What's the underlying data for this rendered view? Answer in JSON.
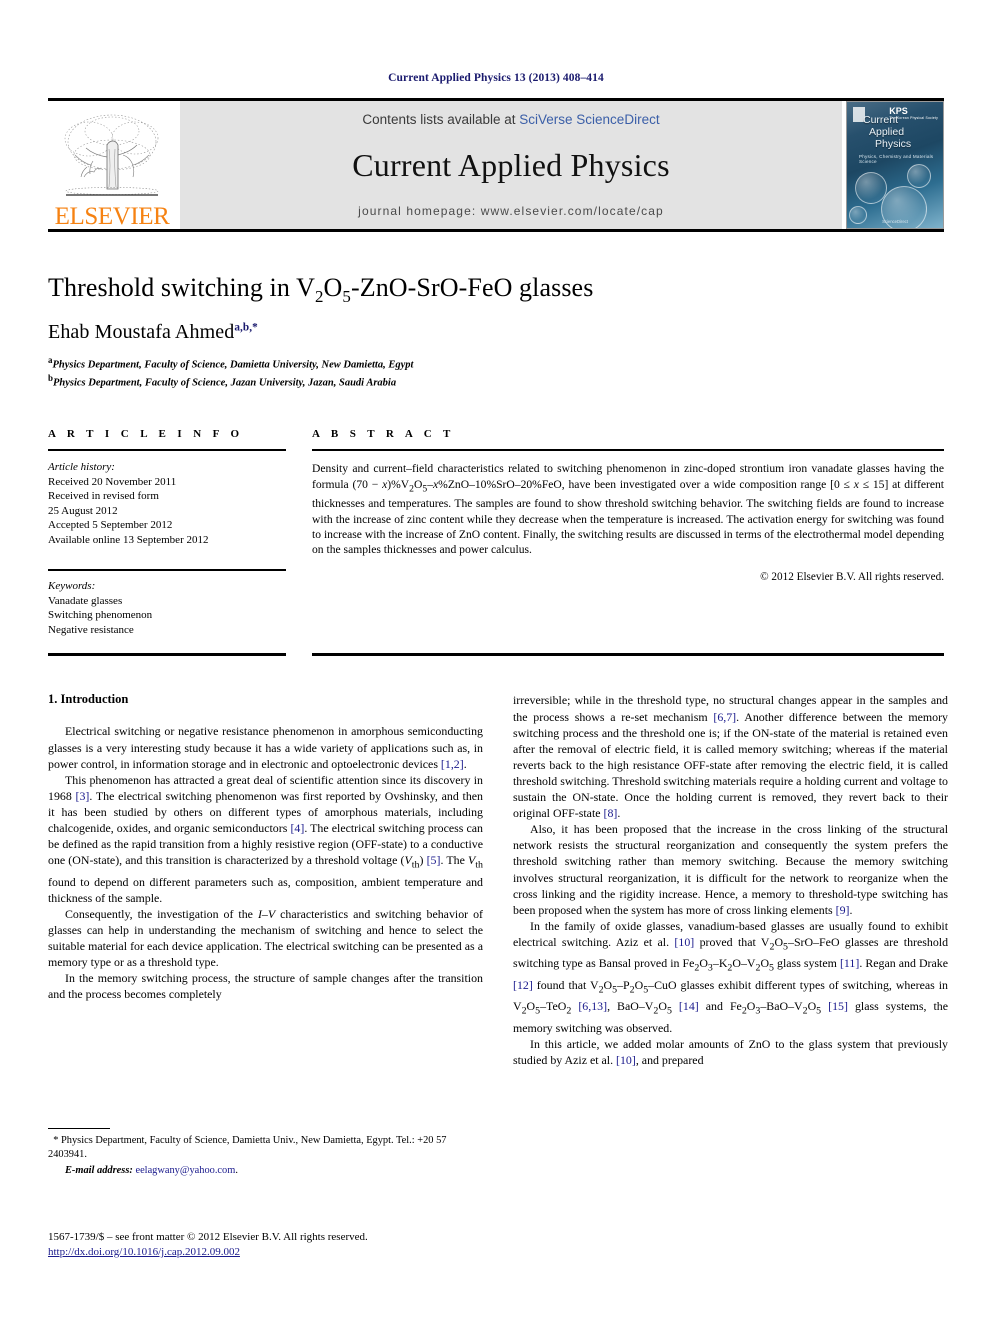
{
  "running_head": "Current Applied Physics 13 (2013) 408–414",
  "masthead": {
    "publisher_wordmark": "ELSEVIER",
    "contents_prefix": "Contents lists available at ",
    "contents_link": "SciVerse ScienceDirect",
    "journal_name": "Current Applied Physics",
    "homepage_label": "journal homepage: www.elsevier.com/locate/cap",
    "cover": {
      "title_line1": "Current",
      "title_line2": "Applied",
      "title_line3": "Physics",
      "subtitle": "Physics, Chemistry and Materials Science",
      "society_badge": "KPS",
      "society_badge_sub": "The Korean Physical Society",
      "footer": "ScienceDirect"
    }
  },
  "article": {
    "title_prefix": "Threshold switching in V",
    "title_full": "Threshold switching in V2O5-ZnO-SrO-FeO glasses",
    "title_parts": {
      "p1": "Threshold switching in V",
      "s1": "2",
      "p2": "O",
      "s2": "5",
      "p3": "-ZnO-SrO-FeO glasses"
    },
    "author": "Ehab Moustafa Ahmed",
    "author_marks": "a,b,",
    "author_star": "*",
    "affiliations": [
      {
        "mark": "a",
        "text": "Physics Department, Faculty of Science, Damietta University, New Damietta, Egypt"
      },
      {
        "mark": "b",
        "text": "Physics Department, Faculty of Science, Jazan University, Jazan, Saudi Arabia"
      }
    ]
  },
  "article_info": {
    "heading": "A R T I C L E   I N F O",
    "history_label": "Article history:",
    "history": [
      "Received 20 November 2011",
      "Received in revised form",
      "25 August 2012",
      "Accepted 5 September 2012",
      "Available online 13 September 2012"
    ],
    "keywords_label": "Keywords:",
    "keywords": [
      "Vanadate glasses",
      "Switching phenomenon",
      "Negative resistance"
    ]
  },
  "abstract": {
    "heading": "A B S T R A C T",
    "p1_a": "Density and current–field characteristics related to switching phenomenon in zinc-doped strontium iron vanadate glasses having the formula (70 − ",
    "x1": "x",
    "p1_b": ")%V",
    "sub2": "2",
    "p1_c": "O",
    "sub5": "5",
    "p1_d": "–",
    "x2": "x",
    "p1_e": "%ZnO–10%SrO–20%FeO, have been investigated over a wide composition range [0 ≤ ",
    "x3": "x",
    "p1_f": " ≤ 15] at different thicknesses and temperatures. The samples are found to show threshold switching behavior. The switching fields are found to increase with the increase of zinc content while they decrease when the temperature is increased. The activation energy for switching was found to increase with the increase of ZnO content. Finally, the switching results are discussed in terms of the electrothermal model depending on the samples thicknesses and power calculus.",
    "copyright": "© 2012 Elsevier B.V. All rights reserved."
  },
  "introduction": {
    "section_number_title": "1.  Introduction",
    "left_paragraphs": [
      "Electrical switching or negative resistance phenomenon in amorphous semiconducting glasses is a very interesting study because it has a wide variety of applications such as, in power control, in information storage and in electronic and optoelectronic devices [1,2].",
      "This phenomenon has attracted a great deal of scientific attention since its discovery in 1968 [3]. The electrical switching phenomenon was first reported by Ovshinsky, and then it has been studied by others on different types of amorphous materials, including chalcogenide, oxides, and organic semiconductors [4]. The electrical switching process can be defined as the rapid transition from a highly resistive region (OFF-state) to a conductive one (ON-state), and this transition is characterized by a threshold voltage (Vth) [5]. The Vth found to depend on different parameters such as, composition, ambient temperature and thickness of the sample.",
      "Consequently, the investigation of the I–V characteristics and switching behavior of glasses can help in understanding the mechanism of switching and hence to select the suitable material for each device application. The electrical switching can be presented as a memory type or as a threshold type.",
      "In the memory switching process, the structure of sample changes after the transition and the process becomes completely"
    ],
    "right_paragraphs": [
      "irreversible; while in the threshold type, no structural changes appear in the samples and the process shows a re-set mechanism [6,7]. Another difference between the memory switching process and the threshold one is; if the ON-state of the material is retained even after the removal of electric field, it is called memory switching; whereas if the material reverts back to the high resistance OFF-state after removing the electric field, it is called threshold switching. Threshold switching materials require a holding current and voltage to sustain the ON-state. Once the holding current is removed, they revert back to their original OFF-state [8].",
      "Also, it has been proposed that the increase in the cross linking of the structural network resists the structural reorganization and consequently the system prefers the threshold switching rather than memory switching. Because the memory switching involves structural reorganization, it is difficult for the network to reorganize when the cross linking and the rigidity increase. Hence, a memory to threshold-type switching has been proposed when the system has more of cross linking elements [9].",
      "In the family of oxide glasses, vanadium-based glasses are usually found to exhibit electrical switching. Aziz et al. [10] proved that V2O5–SrO–FeO glasses are threshold switching type as Bansal proved in Fe2O3–K2O–V2O5 glass system [11]. Regan and Drake [12] found that V2O5–P2O5–CuO glasses exhibit different types of switching, whereas in V2O5–TeO2 [6,13], BaO–V2O5 [14] and Fe2O3–BaO–V2O5 [15] glass systems, the memory switching was observed.",
      "In this article, we added molar amounts of ZnO to the glass system that previously studied by Aziz et al. [10], and prepared"
    ]
  },
  "footnote": {
    "star": "*",
    "corresponding": " Physics Department, Faculty of Science, Damietta Univ., New Damietta, Egypt. Tel.: +20 57 2403941.",
    "email_label": "E-mail address:",
    "email": "eelagwany@yahoo.com"
  },
  "issn_footer": {
    "line1": "1567-1739/$ – see front matter © 2012 Elsevier B.V. All rights reserved.",
    "doi": "http://dx.doi.org/10.1016/j.cap.2012.09.002"
  },
  "colors": {
    "link_blue": "#1a1a8c",
    "sciencedirect_blue": "#3b5fa8",
    "elsevier_orange": "#f68212",
    "banner_grey": "#e3e3e3"
  }
}
